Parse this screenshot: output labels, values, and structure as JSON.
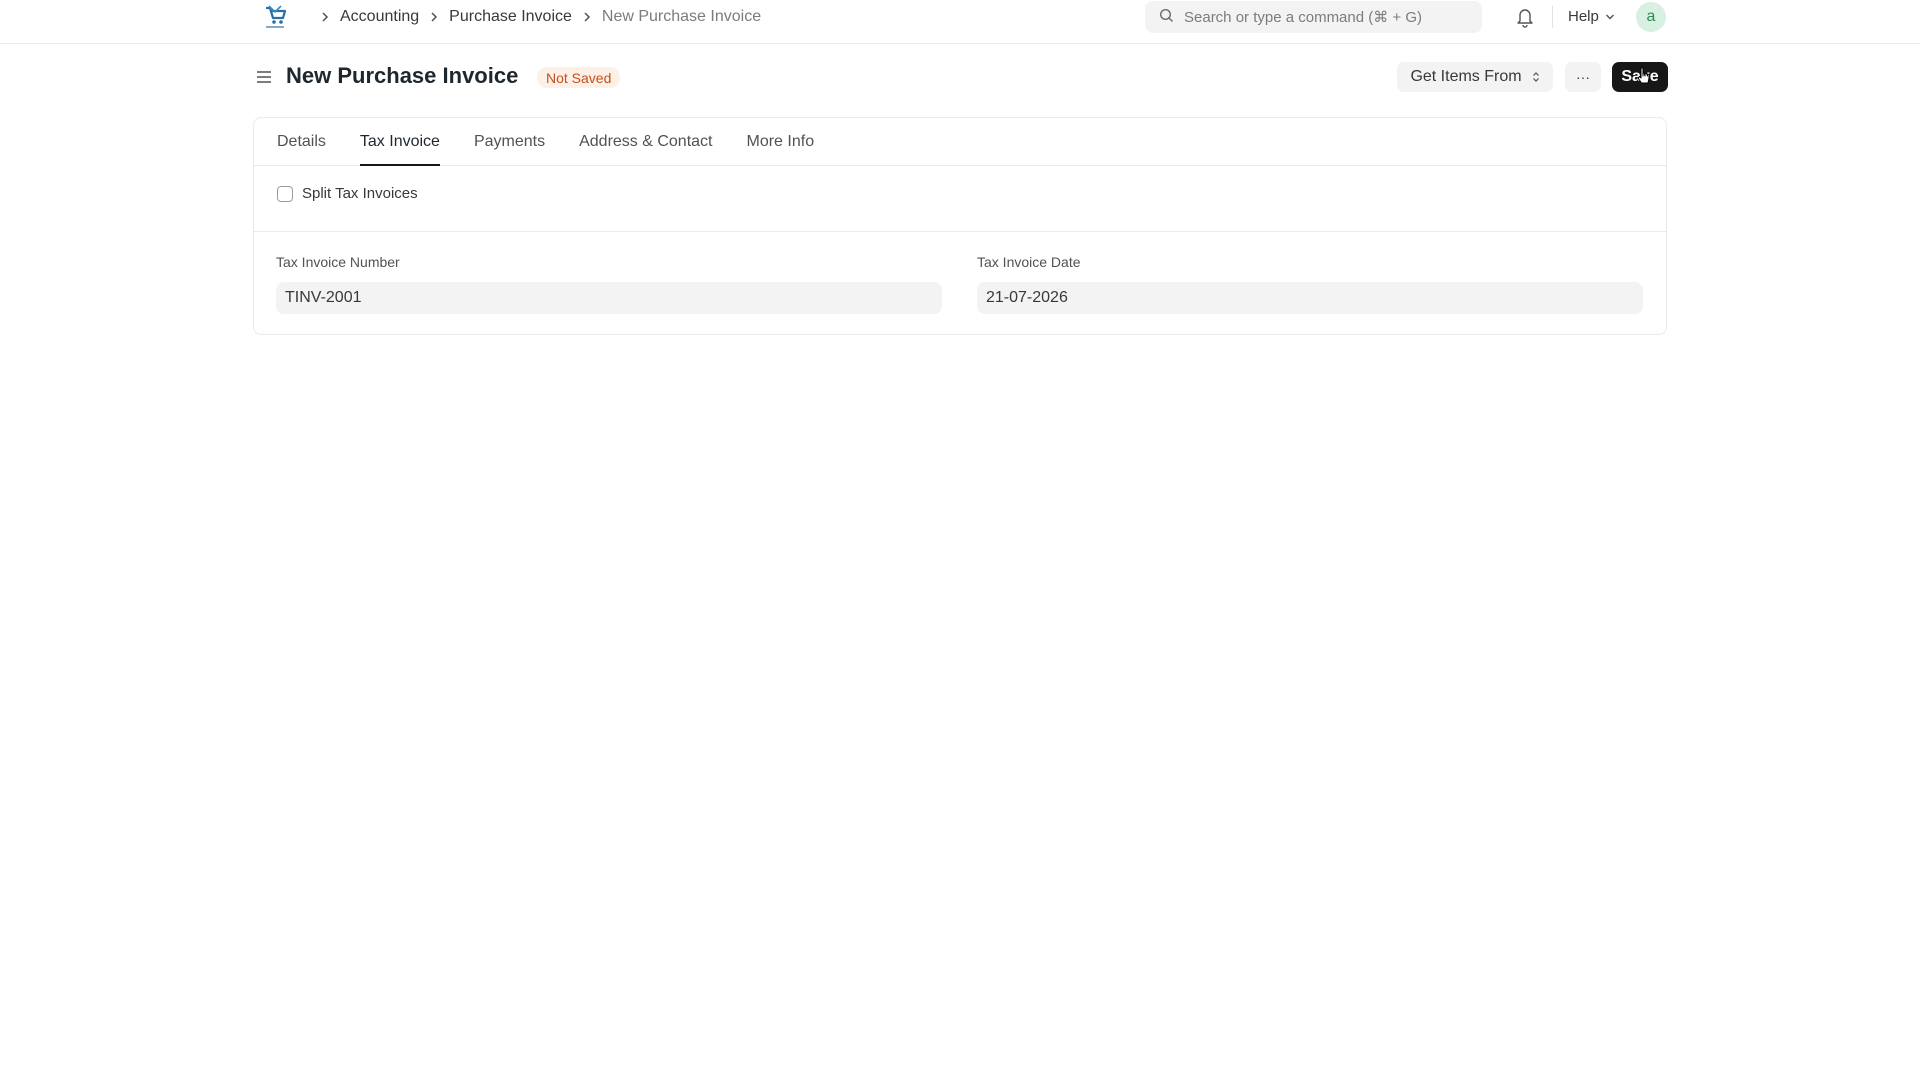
{
  "navbar": {
    "breadcrumbs": [
      "Accounting",
      "Purchase Invoice",
      "New Purchase Invoice"
    ],
    "search_placeholder": "Search or type a command (⌘ + G)",
    "help_label": "Help",
    "avatar_initial": "a"
  },
  "page": {
    "title": "New Purchase Invoice",
    "status": "Not Saved",
    "get_items_label": "Get Items From",
    "more_label": "···",
    "save_label": "Save"
  },
  "tabs": [
    {
      "label": "Details",
      "active": false
    },
    {
      "label": "Tax Invoice",
      "active": true
    },
    {
      "label": "Payments",
      "active": false
    },
    {
      "label": "Address & Contact",
      "active": false
    },
    {
      "label": "More Info",
      "active": false
    }
  ],
  "form": {
    "split_tax_invoices_label": "Split Tax Invoices",
    "split_tax_invoices_checked": false,
    "tax_invoice_number_label": "Tax Invoice Number",
    "tax_invoice_number_value": "TINV-2001",
    "tax_invoice_date_label": "Tax Invoice Date",
    "tax_invoice_date_value": "21-07-2026"
  },
  "colors": {
    "status_badge_bg": "#fdf0e6",
    "status_badge_text": "#c4501c",
    "primary_button": "#171717",
    "avatar_bg": "#d8f0e2"
  }
}
